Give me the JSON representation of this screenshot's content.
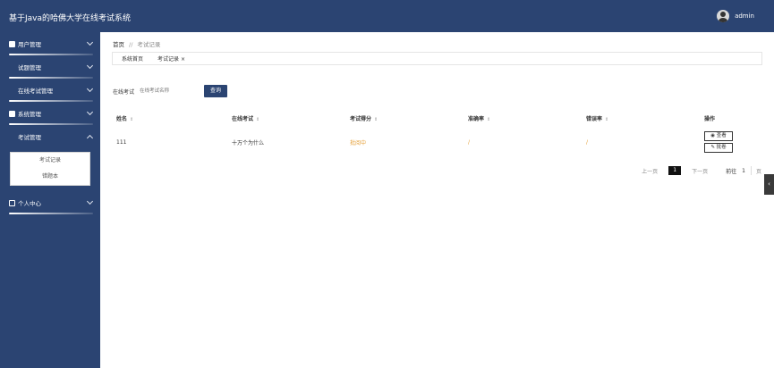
{
  "header": {
    "title": "基于Java的哈佛大学在线考试系统",
    "username": "admin"
  },
  "sidebar": {
    "items": [
      {
        "label": "用户管理"
      },
      {
        "label": "试题管理"
      },
      {
        "label": "在线考试管理"
      },
      {
        "label": "系统管理"
      },
      {
        "label": "考试管理",
        "expanded": true
      },
      {
        "label": "个人中心"
      }
    ],
    "submenu": [
      {
        "label": "考试记录"
      },
      {
        "label": "错题本"
      }
    ]
  },
  "breadcrumb": {
    "home": "首页",
    "separator": "//",
    "current": "考试记录"
  },
  "tabs": [
    {
      "label": "系统首页"
    },
    {
      "label": "考试记录",
      "close": "×"
    }
  ],
  "search": {
    "label": "在线考试",
    "placeholder": "在线考试名称",
    "button": "查询"
  },
  "table": {
    "sort_icon": "⇕",
    "headers": [
      "姓名",
      "在线考试",
      "考试得分",
      "准确率",
      "错误率",
      "操作"
    ],
    "rows": [
      {
        "name": "111",
        "exam": "十万个为什么",
        "score": "批阅中",
        "accuracy": "/",
        "error_rate": "/"
      }
    ],
    "ops": {
      "view": "查看",
      "review": "批卷",
      "view_icon": "eye-icon",
      "review_icon": "edit-icon"
    }
  },
  "pager": {
    "prev": "上一页",
    "current": "1",
    "next": "下一页",
    "goto": "前往",
    "page_num": "1",
    "page_unit": "页"
  },
  "side_toggle": "‹",
  "colors": {
    "primary": "#2b4472",
    "orange": "#e6a23c"
  }
}
